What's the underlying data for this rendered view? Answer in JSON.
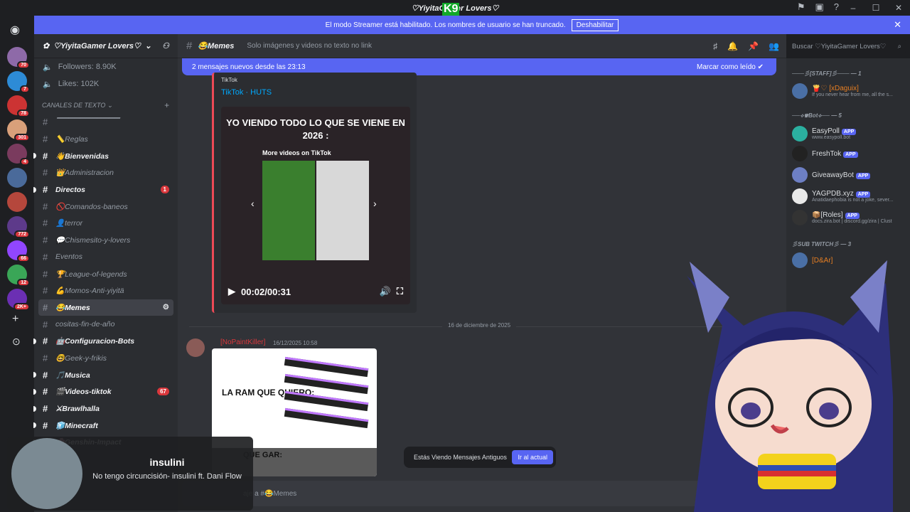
{
  "window": {
    "title": "♡YiyitaGamer Lovers♡",
    "overlay_text": "K9"
  },
  "streamer_bar": {
    "message": "El modo Streamer está habilitado. Los nombres de usuario se han truncado.",
    "button": "Deshabilitar"
  },
  "guild_badges": [
    "70",
    "7",
    "78",
    "301",
    "4",
    "",
    "",
    "772",
    "66",
    "12",
    "2K+"
  ],
  "server": {
    "name": "♡YiyitaGamer Lovers♡",
    "stats": [
      {
        "icon": "speaker-icon",
        "label": "Followers: 8.90K"
      },
      {
        "icon": "speaker-icon",
        "label": "Likes: 102K"
      }
    ],
    "category": "CANALES DE TEXTO",
    "channels": [
      {
        "name": "▔▔▔▔▔▔▔▔▔▔▔",
        "unread": false,
        "badge": ""
      },
      {
        "name": "📏Reglas",
        "unread": false,
        "badge": ""
      },
      {
        "name": "👋Bienvenidas",
        "unread": true,
        "badge": ""
      },
      {
        "name": "👑Administracion",
        "unread": false,
        "badge": ""
      },
      {
        "name": "Directos",
        "unread": true,
        "badge": "1"
      },
      {
        "name": "🚫Comandos-baneos",
        "unread": false,
        "badge": ""
      },
      {
        "name": "👤terror",
        "unread": false,
        "badge": ""
      },
      {
        "name": "💬Chismesito-y-lovers",
        "unread": false,
        "badge": ""
      },
      {
        "name": "Eventos",
        "unread": false,
        "badge": ""
      },
      {
        "name": "🏆League-of-legends",
        "unread": false,
        "badge": ""
      },
      {
        "name": "💪Momos-Anti-yiyitä",
        "unread": false,
        "badge": ""
      },
      {
        "name": "😂Memes",
        "unread": false,
        "badge": "",
        "selected": true
      },
      {
        "name": "cositas-fin-de-año",
        "unread": false,
        "badge": ""
      },
      {
        "name": "🤖Configuracion-Bots",
        "unread": true,
        "badge": ""
      },
      {
        "name": "🤓Geek-y-frikis",
        "unread": false,
        "badge": ""
      },
      {
        "name": "🎵Musica",
        "unread": true,
        "badge": ""
      },
      {
        "name": "🎬Videos-tiktok",
        "unread": true,
        "badge": "67"
      },
      {
        "name": "⚔Brawlhalla",
        "unread": true,
        "badge": ""
      },
      {
        "name": "🧊Minecraft",
        "unread": true,
        "badge": ""
      },
      {
        "name": "🌸Genshin-Impact",
        "unread": true,
        "badge": ""
      }
    ]
  },
  "chat": {
    "channel_name": "😂Memes",
    "topic": "Solo imágenes y videos no texto no link",
    "search_placeholder": "Buscar ♡YiyitaGamer Lovers♡",
    "new_messages": "2 mensajes nuevos desde las 23:13",
    "mark_read": "Marcar como leído",
    "embed": {
      "provider": "TikTok",
      "title": "TikTok · HUTS",
      "hook_text": "YO VIENDO TODO LO QUE SE VIENE EN 2026 :",
      "more_videos": "More videos on TikTok",
      "time": "00:02/00:31"
    },
    "date_divider": "16 de diciembre de 2025",
    "message": {
      "author": "[NoPaintKiller]",
      "timestamp": "16/12/2025 10:58",
      "meme_text_1": "LA RAM QUE QUIERO:",
      "meme_text_2": "QUE GAR:"
    },
    "old_messages": "Estás Viendo Mensajes Antiguos",
    "go_current": "Ir al actual",
    "composer_placeholder": "aje a #😂Memes"
  },
  "members": {
    "groups": [
      {
        "title": "───彡[STAFF]彡─── — 1"
      },
      {
        "title": "──⟡♛Bot⟡── — 5"
      },
      {
        "title": "彡SUB TWITCH彡 — 3"
      }
    ],
    "list": [
      {
        "name": "🍟♡ [xDaguix]",
        "sub": "If you never hear from me, all the s...",
        "app": false,
        "color": "red"
      },
      {
        "name": "EasyPoll",
        "sub": "www.easypoll.bot",
        "app": true
      },
      {
        "name": "FreshTok",
        "sub": "",
        "app": true
      },
      {
        "name": "GiveawayBot",
        "sub": "",
        "app": true
      },
      {
        "name": "YAGPDB.xyz",
        "sub": "Anatidaephobia is not a joke, sever...",
        "app": true
      },
      {
        "name": "📦[Roles]",
        "sub": "docs.zira.bot | discord.gg/zira | Clust",
        "app": true
      },
      {
        "name": "[D&Ar]",
        "sub": "",
        "app": false
      }
    ],
    "app_label": "APP"
  },
  "music": {
    "song": "insulini",
    "artist": "No tengo circuncisión- insulini ft. Dani Flow"
  }
}
